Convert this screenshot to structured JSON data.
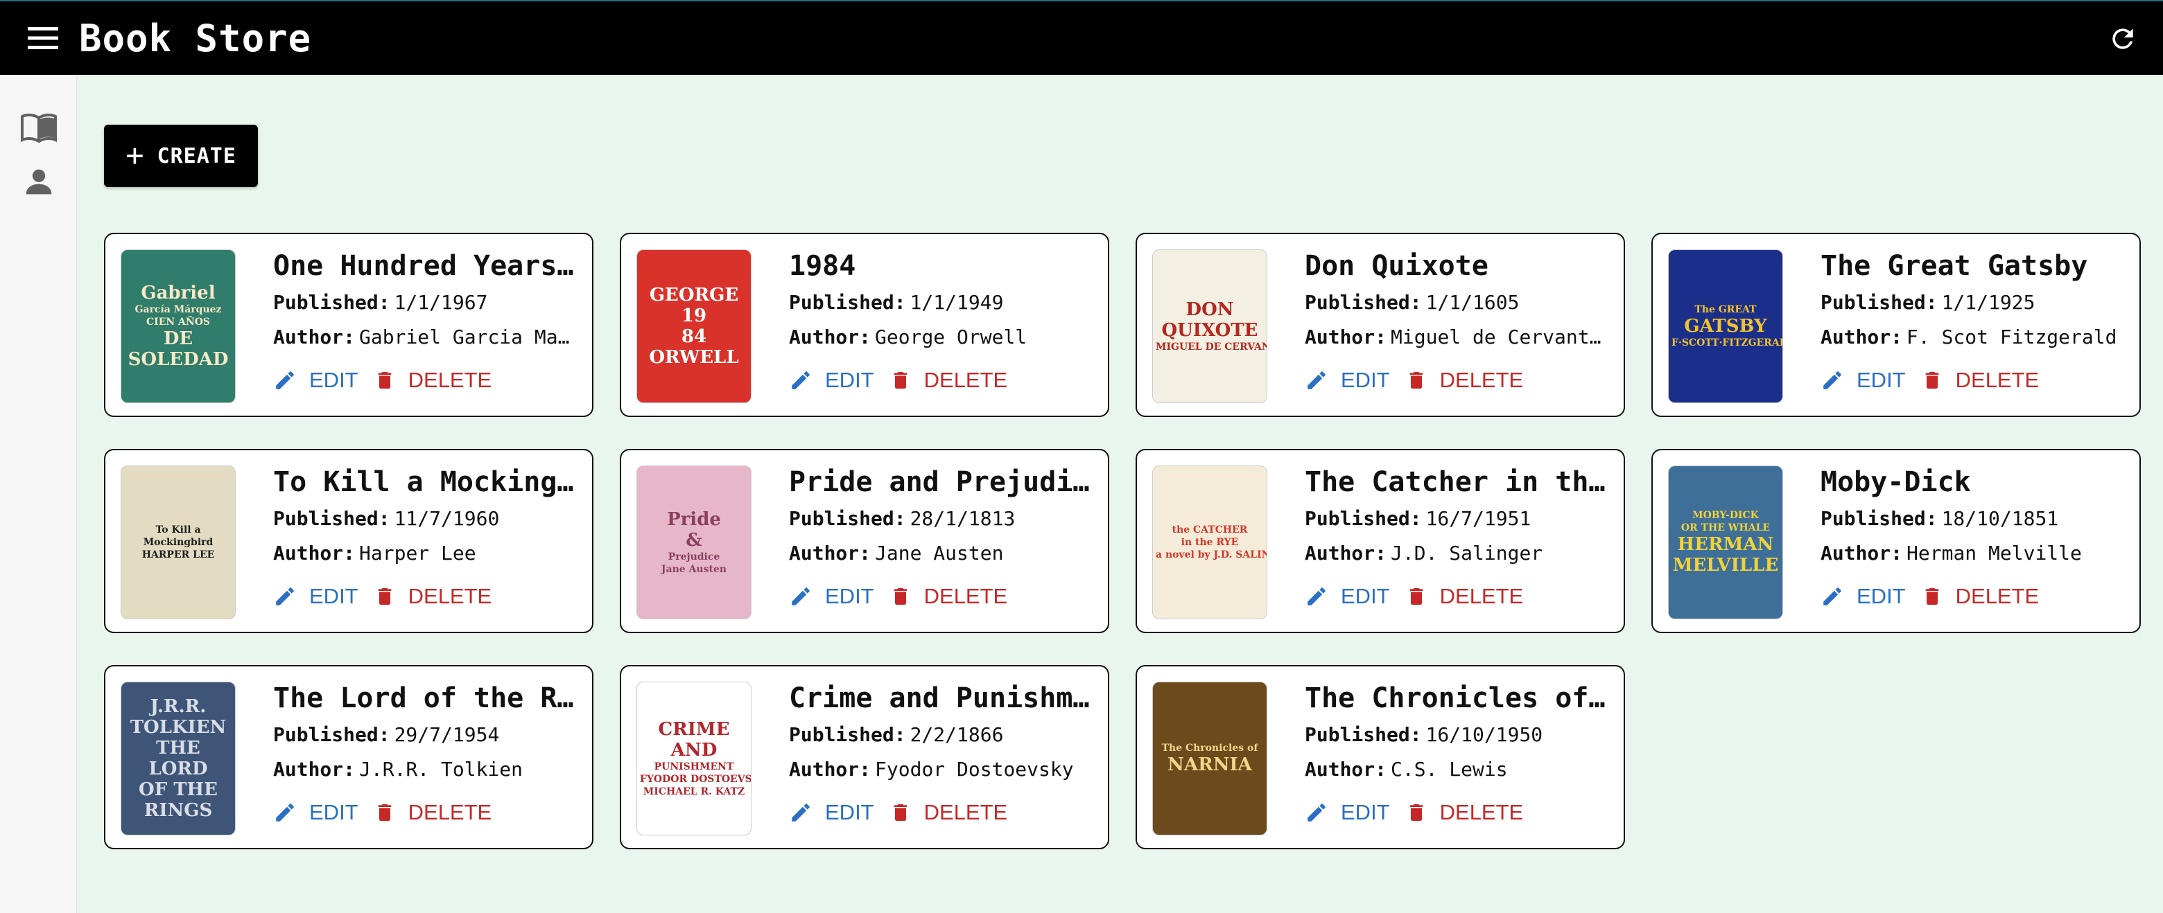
{
  "app": {
    "title": "Book Store"
  },
  "toolbar": {
    "create_label": "CREATE"
  },
  "labels": {
    "published": "Published:",
    "author": "Author:",
    "edit": "EDIT",
    "delete": "DELETE"
  },
  "books": [
    {
      "title": "One Hundred Years of Solitude",
      "published": "1/1/1967",
      "author": "Gabriel Garcia Marquez",
      "cover_text": [
        "Gabriel",
        "García Márquez",
        "CIEN AÑOS",
        "DE",
        "SOLEDAD"
      ],
      "cover_bg": "#2f7d6a"
    },
    {
      "title": "1984",
      "published": "1/1/1949",
      "author": "George Orwell",
      "cover_text": [
        "GEORGE",
        "19",
        "84",
        "ORWELL"
      ],
      "cover_bg": "#d9322a"
    },
    {
      "title": "Don Quixote",
      "published": "1/1/1605",
      "author": "Miguel de Cervantes",
      "cover_text": [
        "DON",
        "QUIXOTE",
        "MIGUEL DE CERVANTES"
      ],
      "cover_bg": "#f3efe2"
    },
    {
      "title": "The Great Gatsby",
      "published": "1/1/1925",
      "author": "F. Scot Fitzgerald",
      "cover_text": [
        "The GREAT",
        "GATSBY",
        "F·SCOTT·FITZGERALD"
      ],
      "cover_bg": "#1b2f8a"
    },
    {
      "title": "To Kill a Mockingbird",
      "published": "11/7/1960",
      "author": "Harper Lee",
      "cover_text": [
        "To Kill a",
        "Mockingbird",
        "HARPER LEE"
      ],
      "cover_bg": "#e4dcc2"
    },
    {
      "title": "Pride and Prejudice",
      "published": "28/1/1813",
      "author": "Jane Austen",
      "cover_text": [
        "Pride",
        "&",
        "Prejudice",
        "Jane Austen"
      ],
      "cover_bg": "#e6b7c9"
    },
    {
      "title": "The Catcher in the Rye",
      "published": "16/7/1951",
      "author": "J.D. Salinger",
      "cover_text": [
        "the CATCHER",
        "in the RYE",
        "a novel by J.D. SALINGER"
      ],
      "cover_bg": "#f4ecd8"
    },
    {
      "title": "Moby-Dick",
      "published": "18/10/1851",
      "author": "Herman Melville",
      "cover_text": [
        "MOBY-DICK",
        "OR THE WHALE",
        "HERMAN",
        "MELVILLE"
      ],
      "cover_bg": "#3d6f98"
    },
    {
      "title": "The Lord of the Rings",
      "published": "29/7/1954",
      "author": "J.R.R. Tolkien",
      "cover_text": [
        "J.R.R.",
        "TOLKIEN",
        "THE",
        "LORD",
        "OF THE",
        "RINGS"
      ],
      "cover_bg": "#3f5578"
    },
    {
      "title": "Crime and Punishment",
      "published": "2/2/1866",
      "author": "Fyodor Dostoevsky",
      "cover_text": [
        "CRIME",
        "AND",
        "PUNISHMENT",
        "FYODOR DOSTOEVSKY",
        "MICHAEL R. KATZ"
      ],
      "cover_bg": "#ffffff"
    },
    {
      "title": "The Chronicles of Narnia",
      "published": "16/10/1950",
      "author": "C.S. Lewis",
      "cover_text": [
        "The Chronicles of",
        "NARNIA"
      ],
      "cover_bg": "#6b4a1c"
    }
  ],
  "colors": {
    "accent_edit": "#2a6fc4",
    "accent_delete": "#c62828",
    "page_bg": "#e8f6ee",
    "appbar_bg": "#000000"
  }
}
